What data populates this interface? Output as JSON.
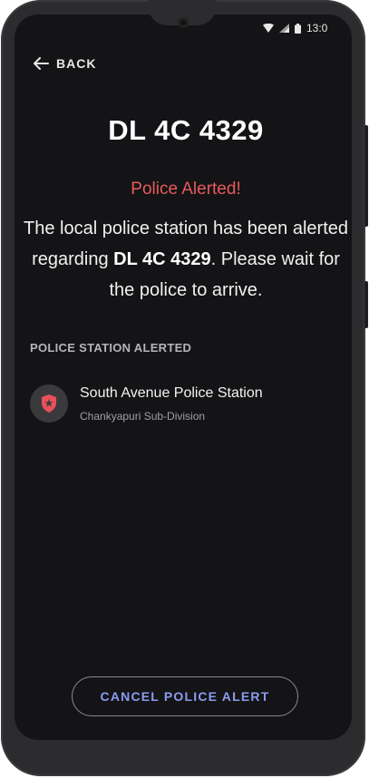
{
  "status_bar": {
    "time": "13:0",
    "icons": [
      "wifi-icon",
      "signal-icon",
      "battery-icon"
    ]
  },
  "header": {
    "back_label": "BACK"
  },
  "vehicle": {
    "plate": "DL 4C 4329"
  },
  "alert": {
    "status": "Police Alerted!",
    "message_part1": "The local police station has been alerted regarding ",
    "message_plate": "DL 4C 4329",
    "message_part2": ". Please wait for the police to arrive."
  },
  "section": {
    "label": "POLICE STATION ALERTED"
  },
  "station": {
    "icon": "police-badge-icon",
    "name": "South Avenue Police Station",
    "subdivision": "Chankyapuri Sub-Division"
  },
  "actions": {
    "cancel_label": "CANCEL POLICE ALERT"
  },
  "colors": {
    "alert": "#e85a5a",
    "accent": "#8a9cf0",
    "badge": "#e8505b",
    "background": "#141416"
  }
}
